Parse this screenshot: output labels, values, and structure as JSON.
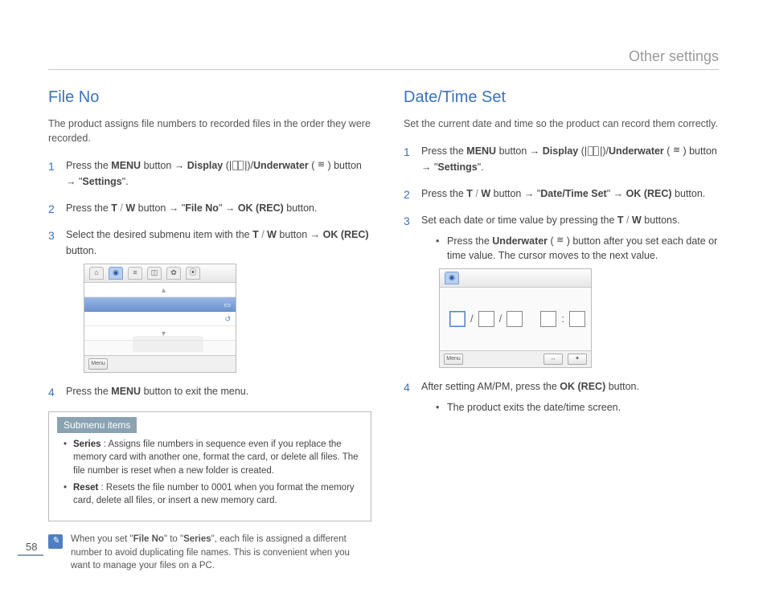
{
  "pageHeader": "Other settings",
  "pageNumber": "58",
  "left": {
    "title": "File No",
    "intro": "The product assigns file numbers to recorded files in the order they were recorded.",
    "steps": {
      "s1": {
        "p1": "Press the ",
        "menu": "MENU",
        "p2": " button → ",
        "display": "Display",
        "p3": " (",
        "p4": ")/",
        "underwater": "Underwater",
        "p5": " (",
        "p6": ") button → \"",
        "settings": "Settings",
        "p7": "\"."
      },
      "s2": {
        "p1": "Press the ",
        "t": "T",
        "sep": " / ",
        "w": "W",
        "p2": " button → \"",
        "fileno": "File No",
        "p3": "\" → ",
        "ok": "OK (REC)",
        "p4": " button."
      },
      "s3": {
        "p1": "Select the desired submenu item with the ",
        "t": "T",
        "sep": " / ",
        "w": "W",
        "p2": " button → ",
        "ok": "OK (REC)",
        "p3": " button."
      },
      "s4": {
        "p1": "Press the ",
        "menu": "MENU",
        "p2": " button to exit the menu."
      }
    },
    "submenuTitle": "Submenu items",
    "submenu": {
      "series": {
        "term": "Series",
        "desc": "Assigns file numbers in sequence even if you replace the memory card with another one, format the card, or delete all files. The file number is reset when a new folder is created."
      },
      "reset": {
        "term": "Reset",
        "desc": "Resets the file number to 0001 when you format the memory card, delete all files, or insert a new memory card."
      }
    },
    "tip": {
      "p1": "When you set \"",
      "t1": "File No",
      "p2": "\" to \"",
      "t2": "Series",
      "p3": "\", each file is assigned a different number to avoid duplicating file names. This is convenient when you want to manage your files on a PC."
    }
  },
  "right": {
    "title": "Date/Time Set",
    "intro": "Set the current date and time so the product can record them correctly.",
    "steps": {
      "s1": {
        "p1": "Press the ",
        "menu": "MENU",
        "p2": " button → ",
        "display": "Display",
        "p3": " (",
        "p4": ")/",
        "underwater": "Underwater",
        "p5": " (",
        "p6": ") button → \"",
        "settings": "Settings",
        "p7": "\"."
      },
      "s2": {
        "p1": "Press the ",
        "t": "T",
        "sep": " / ",
        "w": "W",
        "p2": " button → \"",
        "dts": "Date/Time Set",
        "p3": "\" → ",
        "ok": "OK (REC)",
        "p4": " button."
      },
      "s3": {
        "p1": "Set each date or time value by pressing the ",
        "t": "T",
        "sep": " / ",
        "w": "W",
        "p2": " buttons.",
        "bullet": {
          "p1": "Press the ",
          "underwater": "Underwater",
          "p2": " (",
          "p3": ") button after you set each date or time value. The cursor moves to the next value."
        }
      },
      "s4": {
        "p1": "After setting AM/PM, press the ",
        "ok": "OK (REC)",
        "p2": " button.",
        "bullet": "The product exits the date/time screen."
      }
    }
  },
  "screen": {
    "menuLabel": "Menu"
  }
}
